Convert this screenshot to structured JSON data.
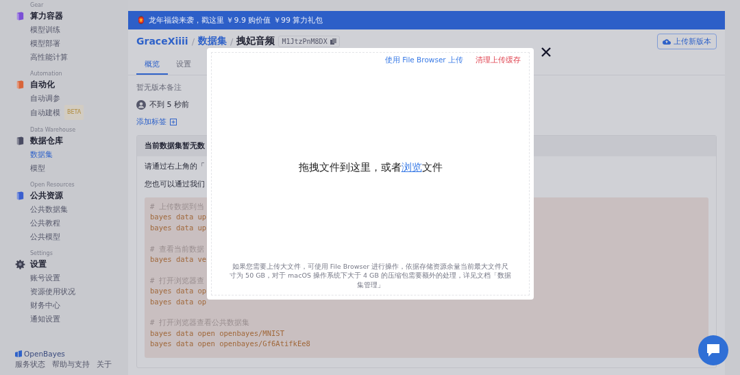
{
  "sidebar": {
    "groups": [
      {
        "label": "Gear",
        "title": "算力容器",
        "items": [
          {
            "label": "模型训练",
            "selected": false
          },
          {
            "label": "模型部署",
            "selected": false
          },
          {
            "label": "高性能计算",
            "selected": false
          }
        ]
      },
      {
        "label": "Automation",
        "title": "自动化",
        "items": [
          {
            "label": "自动调参",
            "selected": false
          },
          {
            "label": "自动建模",
            "selected": false,
            "badge": "BETA"
          }
        ]
      },
      {
        "label": "Data Warehouse",
        "title": "数据仓库",
        "items": [
          {
            "label": "数据集",
            "selected": true
          },
          {
            "label": "模型",
            "selected": false
          }
        ]
      },
      {
        "label": "Open Resources",
        "title": "公共资源",
        "items": [
          {
            "label": "公共数据集",
            "selected": false
          },
          {
            "label": "公共教程",
            "selected": false
          },
          {
            "label": "公共模型",
            "selected": false
          }
        ]
      },
      {
        "label": "Settings",
        "title": "设置",
        "items": [
          {
            "label": "账号设置",
            "selected": false
          },
          {
            "label": "资源使用状况",
            "selected": false
          },
          {
            "label": "财务中心",
            "selected": false
          },
          {
            "label": "通知设置",
            "selected": false
          }
        ]
      }
    ],
    "brand": "OpenBayes",
    "footer_links": [
      "服务状态",
      "帮助与支持",
      "关于"
    ]
  },
  "banner": {
    "icon": "🏮",
    "text": "龙年福袋来袭，戳这里 ￥9.9 购价值 ￥99 算力礼包"
  },
  "breadcrumb": {
    "separator": "/",
    "owner": "GraceXiiii",
    "section": "数据集",
    "name": "拽妃音频",
    "id": "M1JtzPnM8DX"
  },
  "upload_button": "上传新版本",
  "tabs": [
    {
      "label": "概览",
      "selected": true
    },
    {
      "label": "设置",
      "selected": false
    }
  ],
  "version_note": "暂无版本备注",
  "updated": "不到 5 秒前",
  "add_tag": "添加标签",
  "card": {
    "title": "当前数据集暂无数",
    "lines": [
      "请通过右上角的「",
      "您也可以通过我们"
    ],
    "code": [
      {
        "comment": "# 上传数据到当",
        "commands": [
          "bayes data up",
          "bayes data up"
        ]
      },
      {
        "comment": "# 查看当前数据",
        "commands": [
          "bayes data ve"
        ]
      },
      {
        "comment": "# 打开浏览器查",
        "commands": [
          "bayes data op",
          "bayes data op"
        ]
      },
      {
        "comment": "# 打开浏览器查看公共数据集",
        "commands": [
          "bayes data open openbayes/MNIST",
          "bayes data open openbayes/Gf6AtifkEe8"
        ]
      }
    ]
  },
  "modal": {
    "links": [
      {
        "text": "使用 File Browser 上传",
        "kind": "primary"
      },
      {
        "text": "清理上传缓存",
        "kind": "danger"
      }
    ],
    "drop_prefix": "拖拽文件到这里，或者",
    "browse_link": "浏览",
    "drop_suffix": "文件",
    "note": "如果您需要上传大文件，可使用 File Browser 进行操作，依据存储资源余量当前最大文件尺寸为 50 GB，对于 macOS 操作系统下大于 4 GB 的压缩包需要额外的处理，详见文档「数据集管理」"
  }
}
